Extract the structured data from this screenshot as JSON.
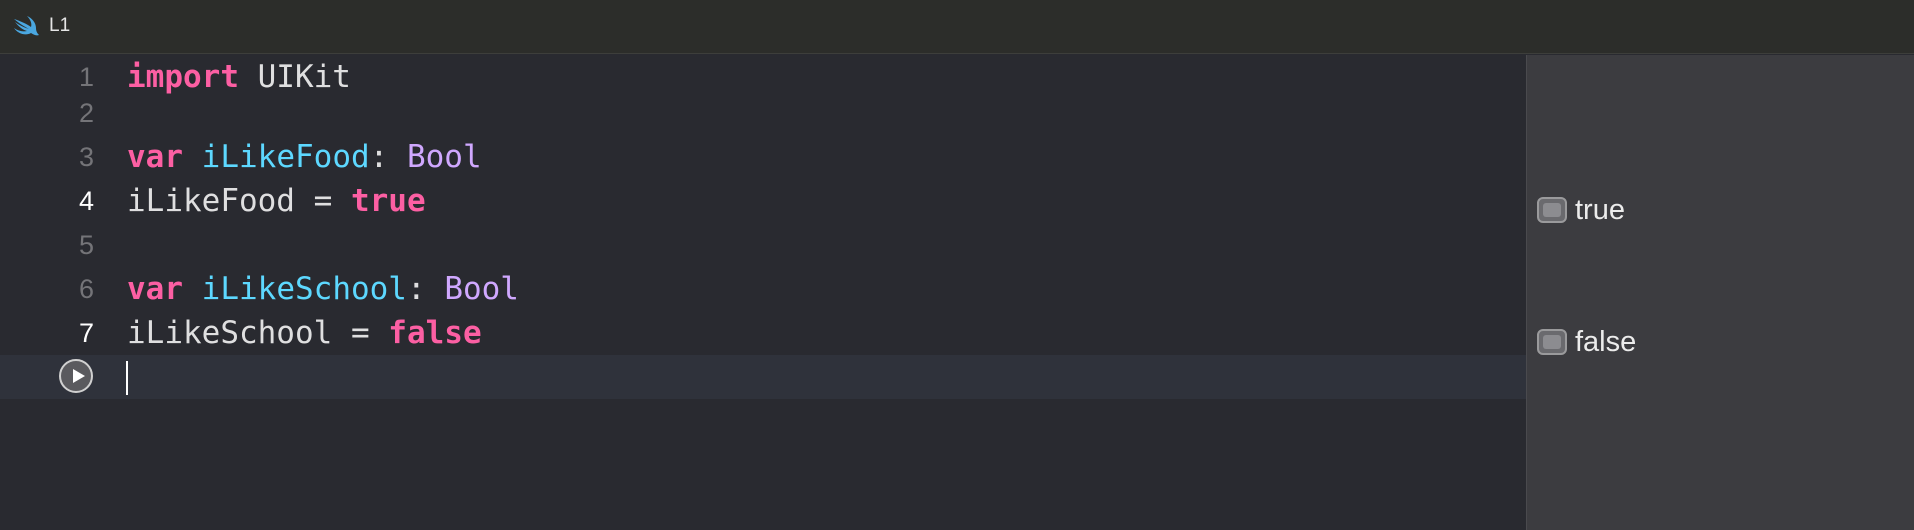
{
  "window": {
    "title": "L1",
    "icon": "swift-icon"
  },
  "editor": {
    "lines": [
      {
        "number": "1",
        "tokens": [
          {
            "t": "import",
            "c": "kw"
          },
          {
            "t": " UIKit",
            "c": "plain"
          }
        ]
      },
      {
        "number": "2",
        "tokens": []
      },
      {
        "number": "3",
        "tokens": [
          {
            "t": "var",
            "c": "kw"
          },
          {
            "t": " ",
            "c": "plain"
          },
          {
            "t": "iLikeFood",
            "c": "decl"
          },
          {
            "t": ": ",
            "c": "plain"
          },
          {
            "t": "Bool",
            "c": "type"
          }
        ]
      },
      {
        "number": "4",
        "tokens": [
          {
            "t": "iLikeFood = ",
            "c": "plain"
          },
          {
            "t": "true",
            "c": "kw"
          }
        ]
      },
      {
        "number": "5",
        "tokens": []
      },
      {
        "number": "6",
        "tokens": [
          {
            "t": "var",
            "c": "kw"
          },
          {
            "t": " ",
            "c": "plain"
          },
          {
            "t": "iLikeSchool",
            "c": "decl"
          },
          {
            "t": ": ",
            "c": "plain"
          },
          {
            "t": "Bool",
            "c": "type"
          }
        ]
      },
      {
        "number": "7",
        "tokens": [
          {
            "t": "iLikeSchool = ",
            "c": "plain"
          },
          {
            "t": "false",
            "c": "kw"
          }
        ]
      }
    ],
    "run_button_icon": "play-icon"
  },
  "results": [
    {
      "line": "4",
      "value": "true"
    },
    {
      "line": "7",
      "value": "false"
    }
  ],
  "colors": {
    "keyword": "#fc5fa3",
    "declaration": "#5dd8ff",
    "type": "#d0a8ff",
    "plain": "#dfdfe0",
    "background": "#292a30",
    "results_panel": "#3c3c40"
  }
}
